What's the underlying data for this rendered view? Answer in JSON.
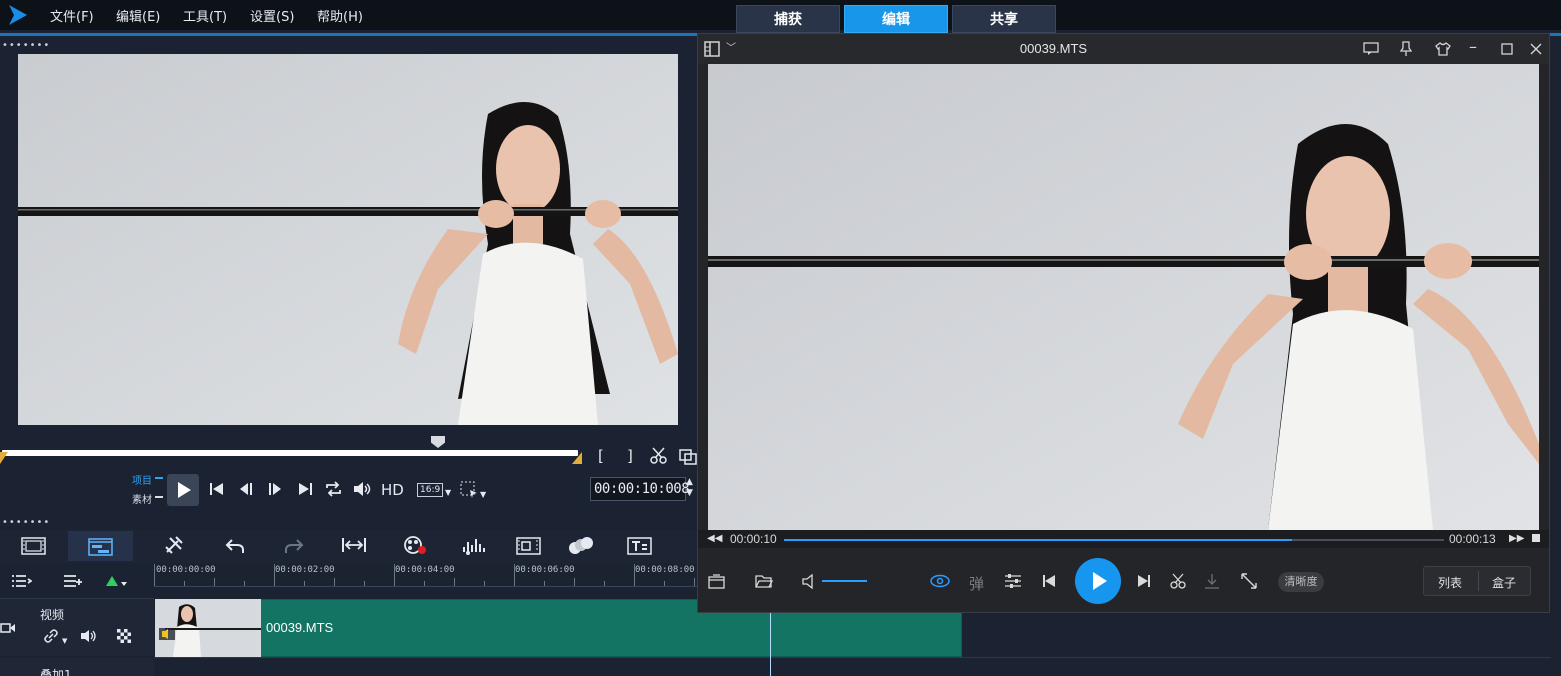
{
  "menu": {
    "file": "文件(F)",
    "edit": "编辑(E)",
    "tools": "工具(T)",
    "settings": "设置(S)",
    "help": "帮助(H)"
  },
  "mode_tabs": [
    {
      "label": "捕获",
      "active": false
    },
    {
      "label": "编辑",
      "active": true
    },
    {
      "label": "共享",
      "active": false
    }
  ],
  "preview": {
    "project_label": "项目",
    "clip_label": "素材",
    "hd_label": "HD",
    "aspect_label": "16:9",
    "timecode": "00:00:10:008",
    "mark_in": "[",
    "mark_out": "]"
  },
  "timeline": {
    "ruler": [
      "00:00:00:00",
      "00:00:02:00",
      "00:00:04:00",
      "00:00:06:00",
      "00:00:08:00"
    ],
    "video_track_label": "视频",
    "overlay_track_label": "叠加1",
    "clip_name": "00039.MTS"
  },
  "player": {
    "title": "00039.MTS",
    "current_time": "00:00:10",
    "total_time": "00:00:13",
    "progress": 0.77,
    "volume": 0.9,
    "danmaku_label": "弹",
    "clarity_label": "清晰度",
    "playlist_label": "列表",
    "box_label": "盒子"
  },
  "colors": {
    "accent": "#1796ea",
    "clip": "#137463",
    "trim": "#e2ad38"
  }
}
